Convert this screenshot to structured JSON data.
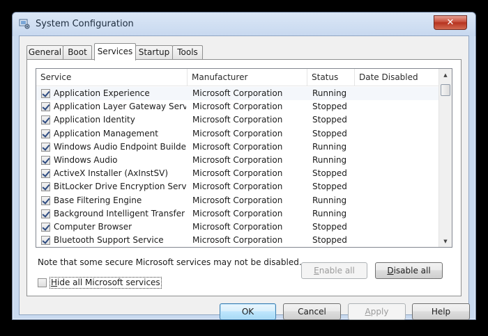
{
  "window": {
    "title": "System Configuration",
    "close_glyph": "✕",
    "icon": "system-config-icon"
  },
  "tabs": [
    {
      "label": "General"
    },
    {
      "label": "Boot"
    },
    {
      "label": "Services",
      "active": true
    },
    {
      "label": "Startup"
    },
    {
      "label": "Tools"
    }
  ],
  "table": {
    "columns": [
      "Service",
      "Manufacturer",
      "Status",
      "Date Disabled"
    ],
    "rows": [
      {
        "service": "Application Experience",
        "manufacturer": "Microsoft Corporation",
        "status": "Running",
        "date_disabled": "",
        "checked": true
      },
      {
        "service": "Application Layer Gateway Service",
        "manufacturer": "Microsoft Corporation",
        "status": "Stopped",
        "date_disabled": "",
        "checked": true
      },
      {
        "service": "Application Identity",
        "manufacturer": "Microsoft Corporation",
        "status": "Stopped",
        "date_disabled": "",
        "checked": true
      },
      {
        "service": "Application Management",
        "manufacturer": "Microsoft Corporation",
        "status": "Stopped",
        "date_disabled": "",
        "checked": true
      },
      {
        "service": "Windows Audio Endpoint Builder",
        "manufacturer": "Microsoft Corporation",
        "status": "Running",
        "date_disabled": "",
        "checked": true
      },
      {
        "service": "Windows Audio",
        "manufacturer": "Microsoft Corporation",
        "status": "Running",
        "date_disabled": "",
        "checked": true
      },
      {
        "service": "ActiveX Installer (AxInstSV)",
        "manufacturer": "Microsoft Corporation",
        "status": "Stopped",
        "date_disabled": "",
        "checked": true
      },
      {
        "service": "BitLocker Drive Encryption Service",
        "manufacturer": "Microsoft Corporation",
        "status": "Stopped",
        "date_disabled": "",
        "checked": true
      },
      {
        "service": "Base Filtering Engine",
        "manufacturer": "Microsoft Corporation",
        "status": "Running",
        "date_disabled": "",
        "checked": true
      },
      {
        "service": "Background Intelligent Transfer ...",
        "manufacturer": "Microsoft Corporation",
        "status": "Running",
        "date_disabled": "",
        "checked": true
      },
      {
        "service": "Computer Browser",
        "manufacturer": "Microsoft Corporation",
        "status": "Stopped",
        "date_disabled": "",
        "checked": true
      },
      {
        "service": "Bluetooth Support Service",
        "manufacturer": "Microsoft Corporation",
        "status": "Stopped",
        "date_disabled": "",
        "checked": true
      }
    ]
  },
  "note": "Note that some secure Microsoft services may not be disabled.",
  "buttons": {
    "enable_all_pre": "",
    "enable_all_u": "E",
    "enable_all_post": "nable all",
    "disable_all_pre": "",
    "disable_all_u": "D",
    "disable_all_post": "isable all",
    "ok": "OK",
    "cancel": "Cancel",
    "apply_pre": "",
    "apply_u": "A",
    "apply_post": "pply",
    "help": "Help"
  },
  "hide_ms": {
    "u": "H",
    "rest": "ide all Microsoft services",
    "checked": false
  }
}
